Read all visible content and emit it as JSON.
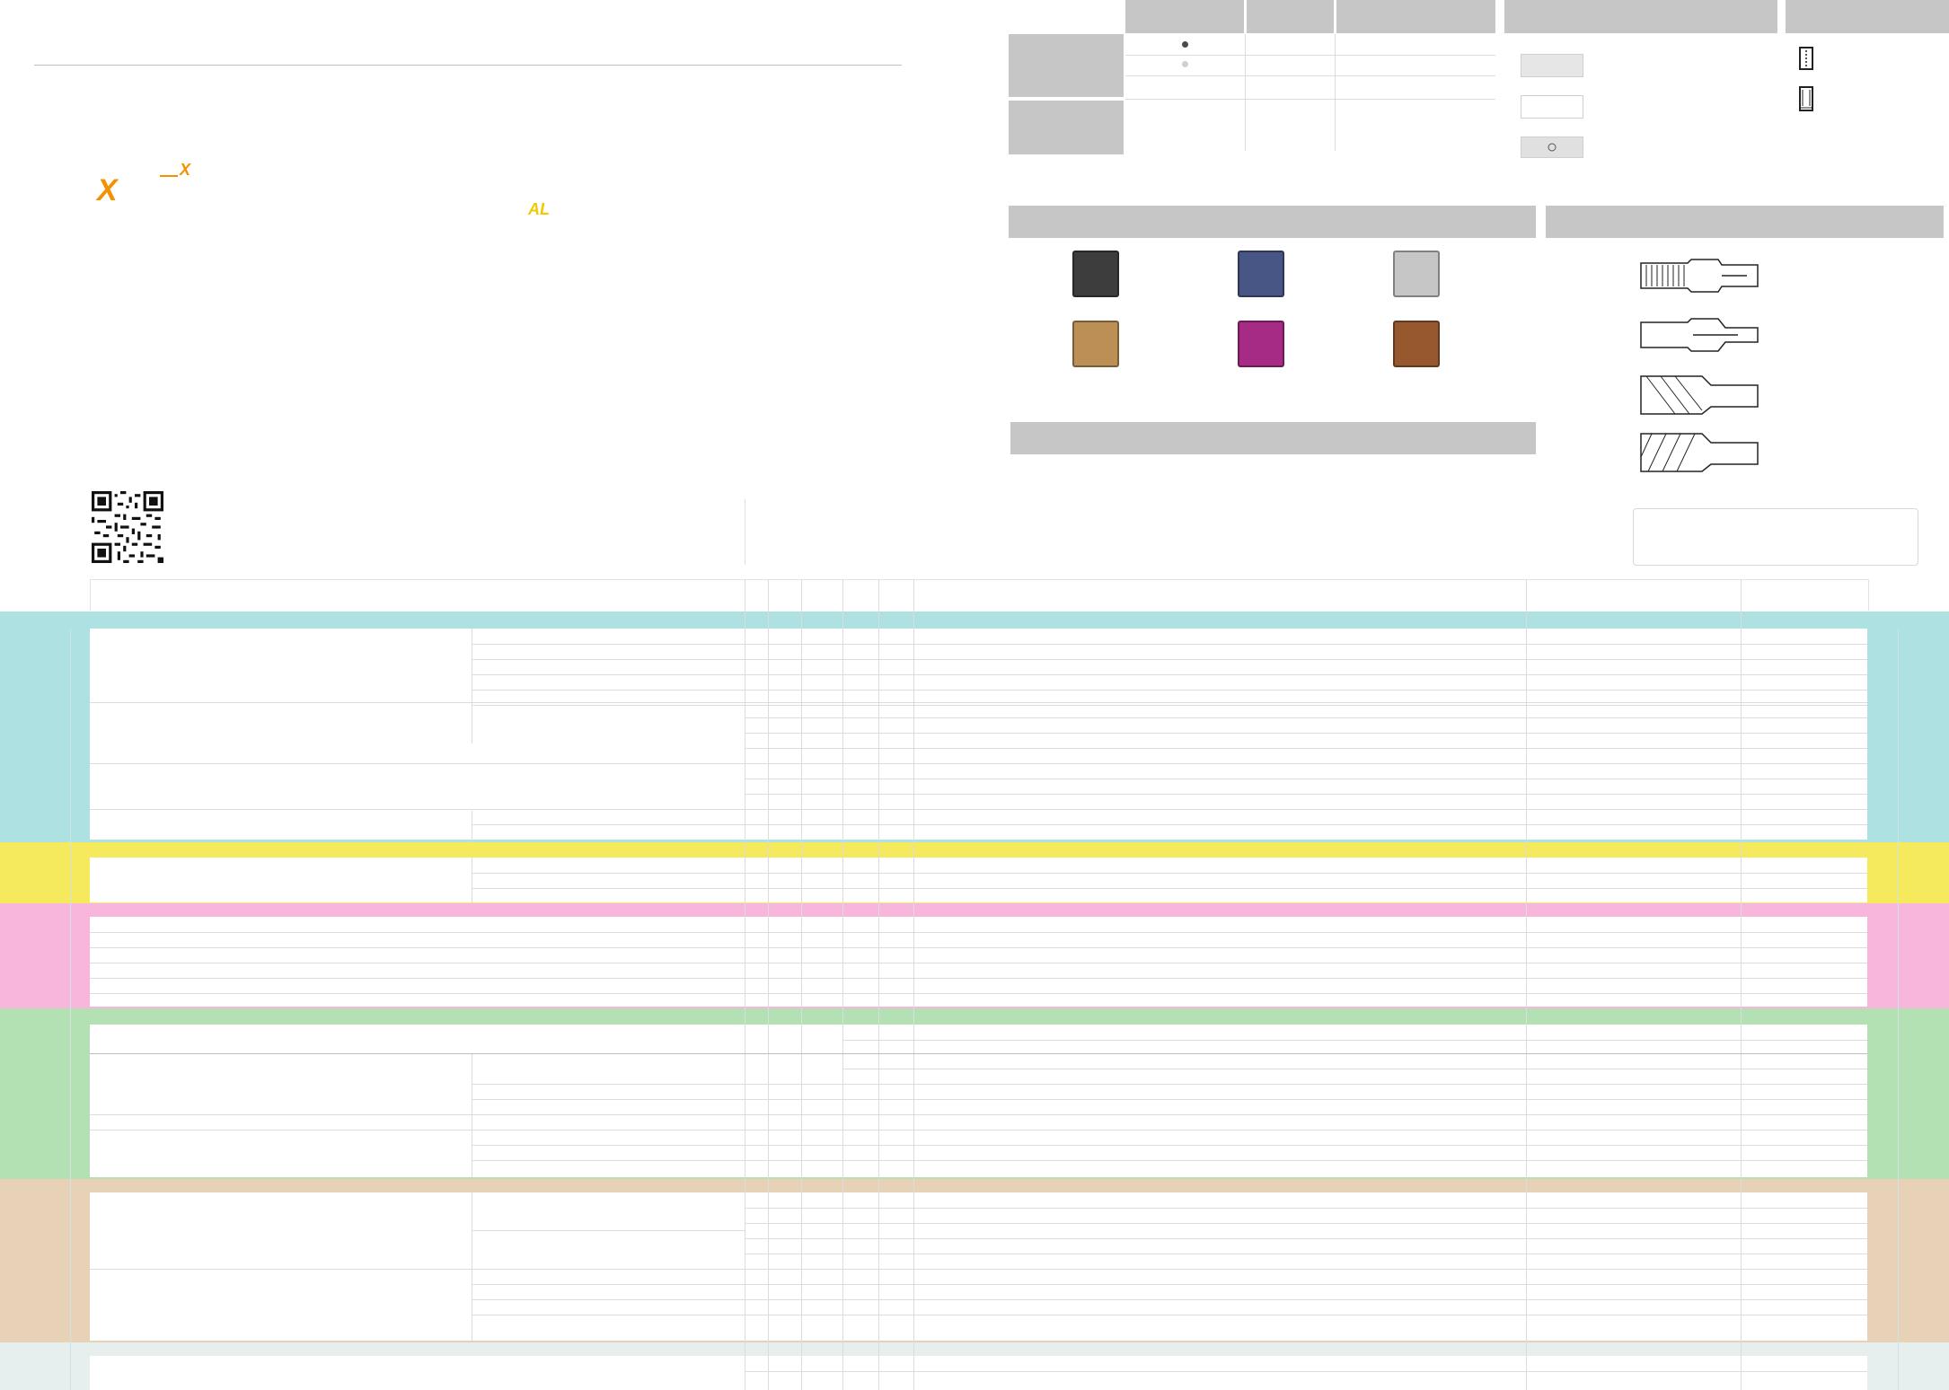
{
  "logo": {
    "mark_primary": "X",
    "mark_secondary": "X",
    "mark_al": "AL",
    "color_primary": "#f29200",
    "color_al": "#f2c900"
  },
  "legend": {
    "swatch_colors": [
      "#3d3d3d",
      "#475684",
      "#c6c6c6",
      "#bb8f55",
      "#a52b84",
      "#96582c"
    ],
    "tool_icons": [
      "tap-straight-flute-icon",
      "tap-spiral-point-icon",
      "drill-spiral-icon",
      "drill-spiral-point-icon"
    ],
    "ratings": [
      "filled-dot",
      "light-dot"
    ]
  },
  "sections": [
    {
      "name": "section-cyan",
      "color": "#ade1e2"
    },
    {
      "name": "section-yellow",
      "color": "#f5e95d"
    },
    {
      "name": "section-pink",
      "color": "#f8b6dc"
    },
    {
      "name": "section-green",
      "color": "#b3e1b3"
    },
    {
      "name": "section-tan",
      "color": "#e7d2b8"
    },
    {
      "name": "section-lightgray",
      "color": "#e6eeee"
    }
  ],
  "qr": {
    "icon": "qr-code-icon"
  }
}
